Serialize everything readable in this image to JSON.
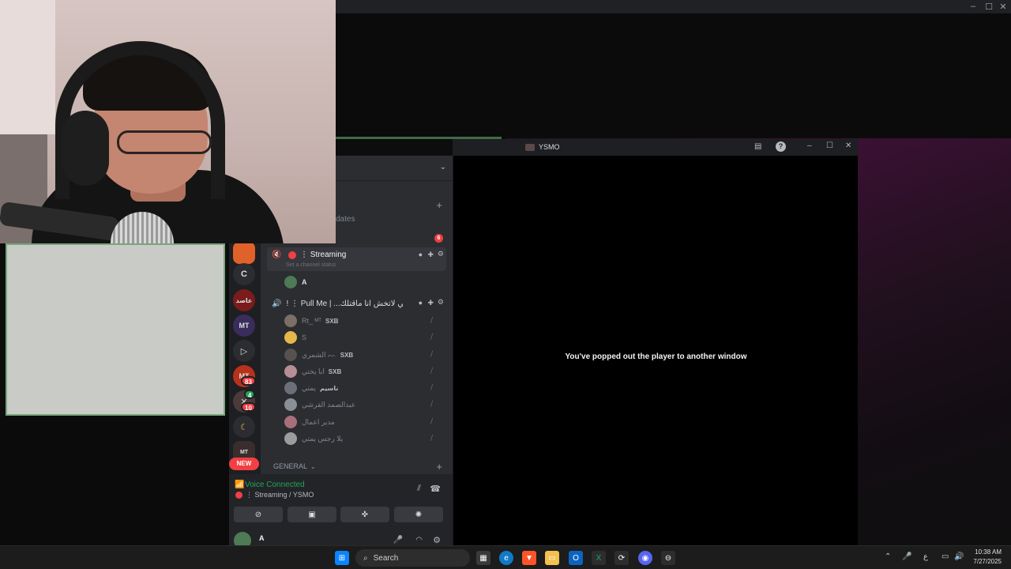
{
  "background_window": {
    "controls": {
      "minimize": "–",
      "maximize": "☐",
      "close": "✕"
    }
  },
  "discord": {
    "partial_text": {
      "updates": "dates",
      "fragment": "ی"
    },
    "unread_count": "6",
    "server_rail": {
      "servers": [
        {
          "name": "server-orange",
          "label": ""
        },
        {
          "name": "server-c",
          "label": "C"
        },
        {
          "name": "server-arabic",
          "label": "عاصد"
        },
        {
          "name": "server-mt",
          "label": "MT"
        },
        {
          "name": "server-play",
          "label": "▷"
        },
        {
          "name": "server-mt-2",
          "label": "MT",
          "badge": "83"
        },
        {
          "name": "server-x",
          "label": "✕",
          "badge": "10",
          "small_badge": "4"
        },
        {
          "name": "server-moon",
          "label": "☾"
        },
        {
          "name": "server-folder",
          "label": "MT"
        }
      ],
      "new_label": "NEW"
    },
    "channels": [
      {
        "name": "⋮ Streaming",
        "status_placeholder": "Set a channel status",
        "users": [
          {
            "name": "A",
            "tag": ""
          }
        ]
      },
      {
        "name": "! ⋮ Pull Me | ...قه يمتي لاتخش انا ماقتلك",
        "users": [
          {
            "name": "Rt_ ᴹᵀ",
            "tag": "SXB",
            "av": "#7b6f68"
          },
          {
            "name": "S",
            "tag": "",
            "av": "#e6b84a"
          },
          {
            "name": "الشمري ᨓ",
            "tag": "SXB",
            "av": "#55524f"
          },
          {
            "name": "ابا يختي",
            "tag": "SXB",
            "av": "#b78d96"
          },
          {
            "name": "يمتي",
            "tag": "ناسيم",
            "av": "#6d6f78"
          },
          {
            "name": "عبدالصمد القرشي",
            "tag": "",
            "av": "#8a8f95"
          },
          {
            "name": "مدير اعمال",
            "tag": "",
            "av": "#a86f7a"
          },
          {
            "name": "يلا رجس يمتي",
            "tag": "",
            "av": "#9c9c9c"
          }
        ]
      }
    ],
    "category": "GENERAL",
    "voice": {
      "status": "Voice Connected",
      "location": "⋮ Streaming / YSMO"
    },
    "current_user": "A"
  },
  "player": {
    "title": "YSMO",
    "message": "You've popped out the player to another window"
  },
  "taskbar": {
    "search_label": "Search",
    "time": "10:38 AM",
    "date": "7/27/2025",
    "lang": "ع"
  },
  "colors": {
    "discord_bg": "#2b2d31",
    "rail_bg": "#1e1f22",
    "voice_green": "#23a55a",
    "red": "#f23f43"
  }
}
